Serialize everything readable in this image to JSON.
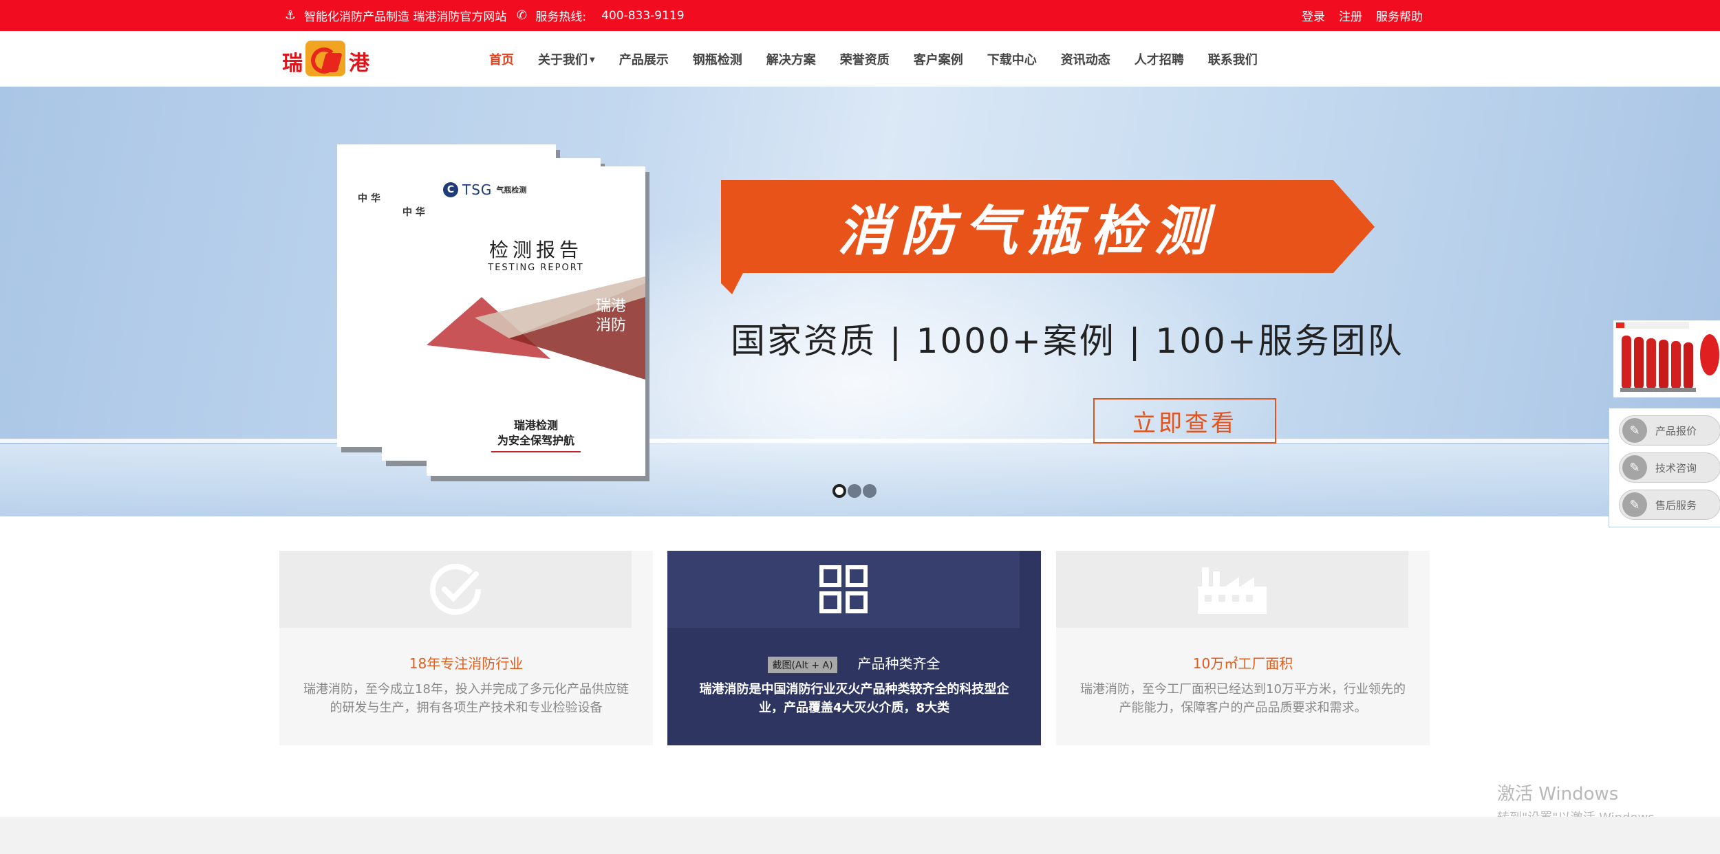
{
  "topbar": {
    "slogan": "智能化消防产品制造 瑞港消防官方网站",
    "hotline_label": "服务热线:",
    "hotline_number": "400-833-9119",
    "login": "登录",
    "register": "注册",
    "help": "服务帮助"
  },
  "logo": {
    "left_char": "瑞",
    "right_char": "港"
  },
  "nav": {
    "items": [
      "首页",
      "关于我们",
      "产品展示",
      "钢瓶检测",
      "解决方案",
      "荣誉资质",
      "客户案例",
      "下载中心",
      "资讯动态",
      "人才招聘",
      "联系我们"
    ],
    "active_index": 0,
    "active_color": "#e0421e"
  },
  "banner": {
    "headline": "消防气瓶检测",
    "tagline": "国家资质 | 1000+案例 | 100+服务团队",
    "cta": "立即查看",
    "doc_brand": "TSG",
    "doc_brand_sub": "气瓶检测",
    "doc_mini_a": "中 华",
    "doc_mini_b": "中 华",
    "report_title": "检测报告",
    "report_subtitle": "TESTING REPORT",
    "report_brand_line1": "瑞港",
    "report_brand_line2": "消防",
    "report_footer_line1": "瑞港检测",
    "report_footer_line2": "为安全保驾护航",
    "slides": 3,
    "active_slide": 0,
    "ribbon_color": "#e8531a"
  },
  "float_panel": {
    "buttons": [
      "产品报价",
      "技术咨询",
      "售后服务"
    ]
  },
  "features": [
    {
      "icon": "check-circle-icon",
      "title": "18年专注消防行业",
      "desc": "瑞港消防，至今成立18年，投入并完成了多元化产品供应链的研发与生产，拥有各项生产技术和专业检验设备"
    },
    {
      "icon": "grid-icon",
      "snip_label": "截图(Alt + A)",
      "title": "产品种类齐全",
      "desc": "瑞港消防是中国消防行业灭火产品种类较齐全的科技型企业，产品覆盖4大灭火介质，8大类"
    },
    {
      "icon": "factory-icon",
      "title": "10万㎡工厂面积",
      "desc": "瑞港消防，至今工厂面积已经达到10万平方米，行业领先的产能能力，保障客户的产品品质要求和需求。"
    }
  ],
  "watermark": {
    "line1": "激活 Windows",
    "line2": "转到\"设置\"以激活 Windows。"
  }
}
